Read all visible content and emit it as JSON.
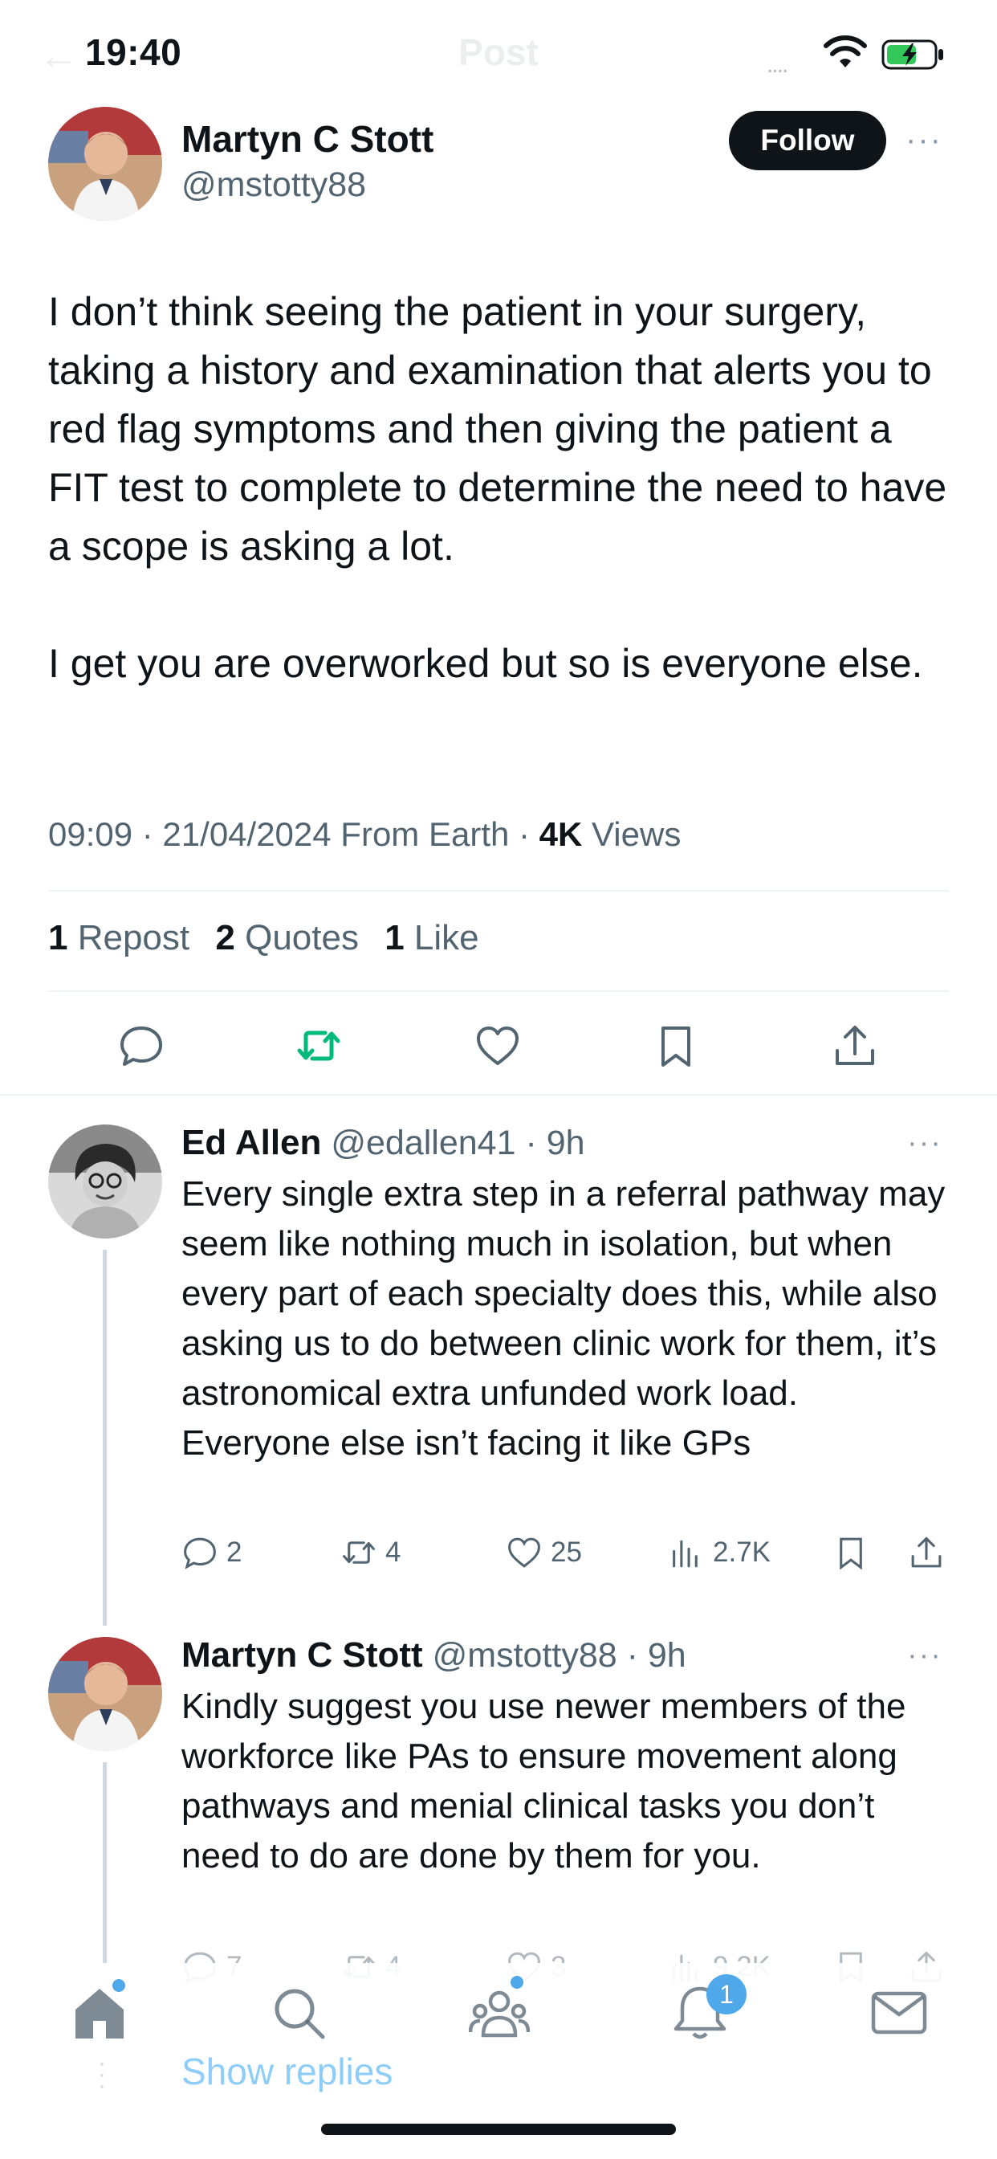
{
  "status_bar": {
    "time": "19:40",
    "header_title": "Post",
    "signal": "....",
    "back_arrow": "←"
  },
  "tweet": {
    "author_name": "Martyn C Stott",
    "author_handle": "@mstotty88",
    "follow_label": "Follow",
    "more": "···",
    "text": "I don’t think seeing the patient in your surgery, taking a history and examination that alerts you to red flag symptoms and then giving the patient a FIT test to complete to determine the need to have a scope is asking a lot.\n\nI get you are overworked but so is everyone else.",
    "meta_time": "09:09 · 21/04/2024 From Earth · ",
    "views_count": "4K",
    "views_label": " Views",
    "reposts_count": "1",
    "reposts_label": "Repost",
    "quotes_count": "2",
    "quotes_label": "Quotes",
    "likes_count": "1",
    "likes_label": "Like",
    "icons": [
      "reply-icon",
      "repost-icon",
      "like-icon",
      "bookmark-icon",
      "share-icon"
    ],
    "repost_color": "#00ba7c"
  },
  "replies": [
    {
      "name": "Ed Allen",
      "handle": "@edallen41",
      "time": " · 9h",
      "more": "···",
      "text": "Every single extra step in a referral pathway may seem like nothing much in isolation, but when every part of each specialty does this, while also asking us to do between clinic work for them, it’s astronomical extra unfunded work load. Everyone else isn’t facing it like GPs",
      "replies": "2",
      "reposts": "4",
      "likes": "25",
      "views": "2.7K"
    },
    {
      "name": "Martyn C Stott",
      "handle": "@mstotty88",
      "time": " · 9h",
      "more": "···",
      "text": "Kindly suggest you use newer members of the workforce like PAs to ensure movement along pathways and menial clinical tasks you don’t need to do are done by them for you.",
      "replies": "7",
      "reposts": "4",
      "likes": "3",
      "views": "9.2K"
    }
  ],
  "show_replies": "Show replies",
  "bottom_nav": {
    "items": [
      "home-icon",
      "search-icon",
      "communities-icon",
      "notifications-icon",
      "messages-icon"
    ],
    "notifications_badge": "1"
  },
  "colors": {
    "accent": "#1d9bf0",
    "text_primary": "#0f1419",
    "text_secondary": "#536471",
    "badge": "#4fa8ea"
  }
}
